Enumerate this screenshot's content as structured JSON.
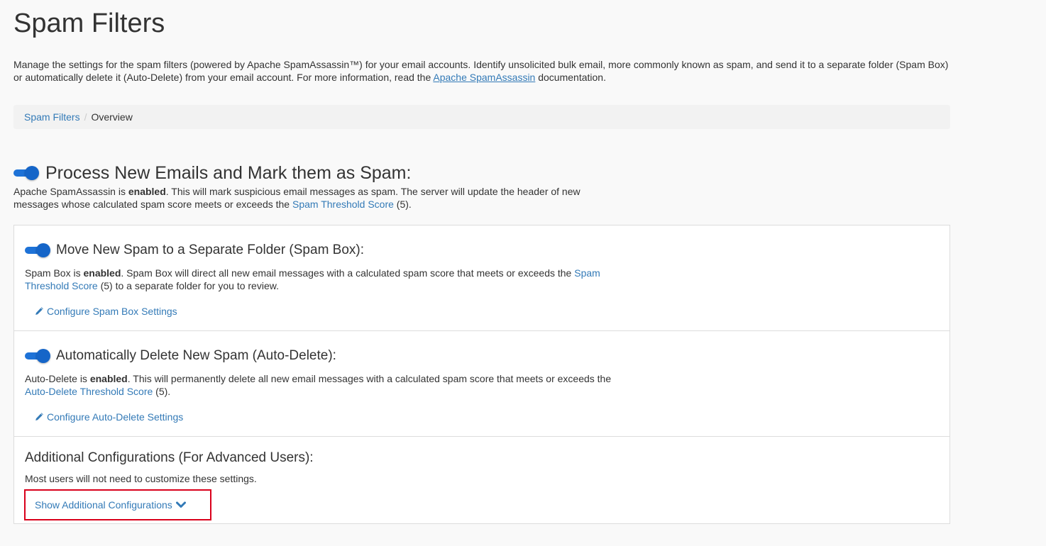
{
  "page": {
    "title": "Spam Filters",
    "intro_text_1": "Manage the settings for the spam filters (powered by Apache SpamAssassin™) for your email accounts. Identify unsolicited bulk email, more commonly known as spam, and send it to a separate folder (Spam Box) or automatically delete it (Auto-Delete) from your email account. For more information, read the ",
    "intro_link": "Apache SpamAssassin",
    "intro_text_2": " documentation."
  },
  "breadcrumb": {
    "parent": "Spam Filters",
    "separator": "/",
    "current": "Overview"
  },
  "process_spam": {
    "enabled": true,
    "heading": "Process New Emails and Mark them as Spam:",
    "desc_1": "Apache SpamAssassin is ",
    "status": "enabled",
    "desc_2": ". This will mark suspicious email messages as spam. The server will update the header of new messages whose calculated spam score meets or exceeds the ",
    "link": "Spam Threshold Score",
    "desc_3": " (5)."
  },
  "spam_box": {
    "enabled": true,
    "heading": "Move New Spam to a Separate Folder (Spam Box):",
    "desc_1": "Spam Box is ",
    "status": "enabled",
    "desc_2": ". Spam Box will direct all new email messages with a calculated spam score that meets or exceeds the ",
    "link": "Spam Threshold Score",
    "desc_3": " (5) to a separate folder for you to review.",
    "configure_label": "Configure Spam Box Settings"
  },
  "auto_delete": {
    "enabled": true,
    "heading": "Automatically Delete New Spam (Auto-Delete):",
    "desc_1": "Auto-Delete is ",
    "status": "enabled",
    "desc_2": ". This will permanently delete all new email messages with a calculated spam score that meets or exceeds the ",
    "link": "Auto-Delete Threshold Score",
    "desc_3": " (5).",
    "configure_label": "Configure Auto-Delete Settings"
  },
  "additional": {
    "heading": "Additional Configurations (For Advanced Users):",
    "desc": "Most users will not need to customize these settings.",
    "show_label": "Show Additional Configurations"
  },
  "colors": {
    "link": "#337ab7",
    "toggle": "#1565c8",
    "highlight_border": "#d9001b"
  },
  "icons": {
    "configure": "pencil-icon",
    "expand": "chevron-down-icon"
  }
}
